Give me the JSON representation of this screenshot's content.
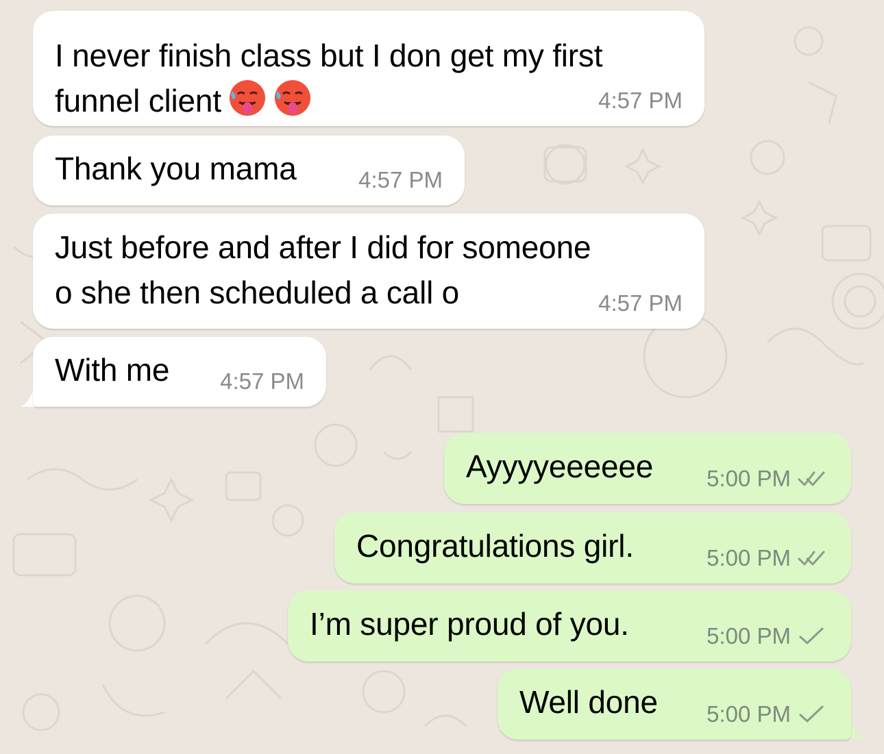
{
  "conversation": {
    "incoming": [
      {
        "lines": [
          "I never finish class but I don get my first",
          "funnel client"
        ],
        "emojis": [
          "hot-face",
          "hot-face"
        ],
        "time": "4:57 PM"
      },
      {
        "lines": [
          "Thank you mama"
        ],
        "time": "4:57 PM"
      },
      {
        "lines": [
          "Just before and after I did for someone",
          "o she then scheduled a call o"
        ],
        "time": "4:57 PM"
      },
      {
        "lines": [
          "With me"
        ],
        "time": "4:57 PM"
      }
    ],
    "outgoing": [
      {
        "text": "Ayyyyeeeeee",
        "time": "5:00 PM",
        "status": "read"
      },
      {
        "text": "Congratulations girl.",
        "time": "5:00 PM",
        "status": "read"
      },
      {
        "text": "I’m super proud of you.",
        "time": "5:00 PM",
        "status": "sent"
      },
      {
        "text": "Well done",
        "time": "5:00 PM",
        "status": "sent"
      }
    ]
  },
  "colors": {
    "wallpaper": "#ECE6DF",
    "incoming_bubble": "#FFFFFF",
    "outgoing_bubble": "#DBF8C6",
    "timestamp": "#8A8A8A"
  },
  "icons": {
    "emoji": "hot-face-emoji",
    "read_receipt": "double-check-icon",
    "sent_receipt": "single-check-icon"
  }
}
